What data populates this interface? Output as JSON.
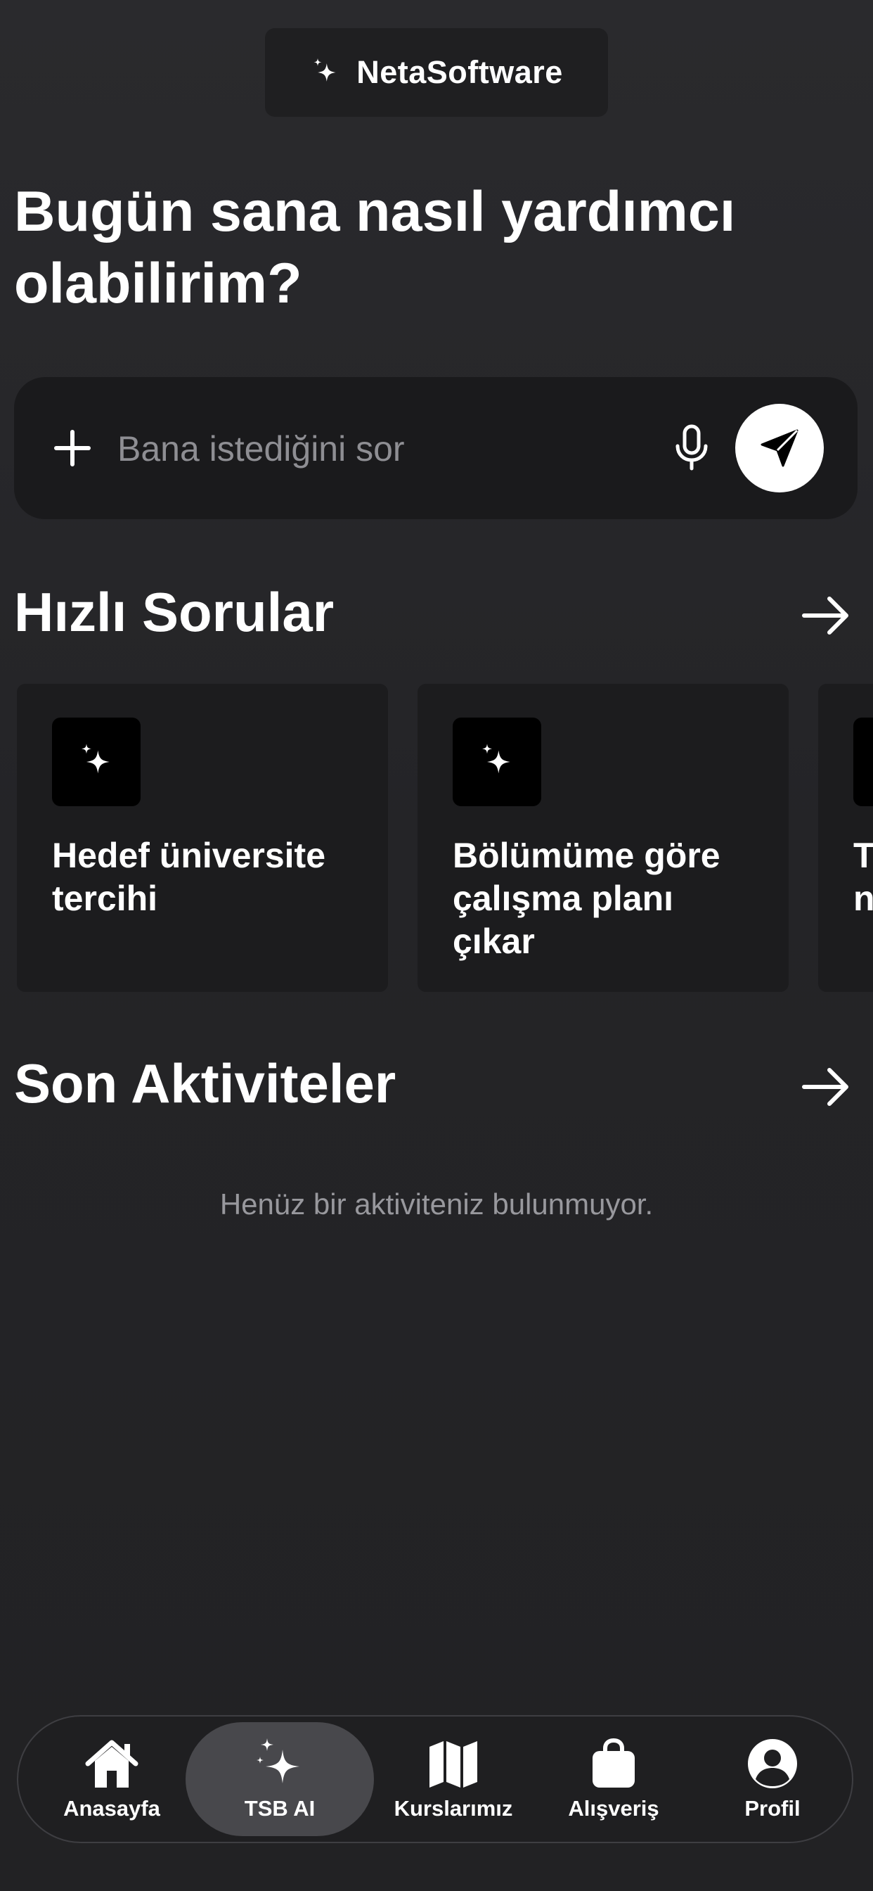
{
  "brand": {
    "name": "NetaSoftware",
    "icon": "sparkles-icon"
  },
  "hero": {
    "title": "Bugün sana nasıl yardımcı olabilirim?"
  },
  "search": {
    "placeholder": "Bana istediğini sor",
    "value": "",
    "icons": [
      "plus-icon",
      "microphone-icon",
      "send-icon"
    ]
  },
  "quick_questions": {
    "title": "Hızlı Sorular",
    "cards": [
      {
        "label": "Hedef üniversite tercihi",
        "icon": "sparkles-icon"
      },
      {
        "label": "Bölümüme göre çalışma planı çıkar",
        "icon": "sparkles-icon"
      },
      {
        "label": "T\nn",
        "icon": "sparkles-icon"
      }
    ]
  },
  "recent_activity": {
    "title": "Son Aktiviteler",
    "empty_message": "Henüz bir aktiviteniz bulunmuyor."
  },
  "tabbar": {
    "items": [
      {
        "label": "Anasayfa",
        "icon": "home-icon"
      },
      {
        "label": "TSB AI",
        "icon": "sparkles-icon",
        "active": true
      },
      {
        "label": "Kurslarımız",
        "icon": "map-icon"
      },
      {
        "label": "Alışveriş",
        "icon": "bag-icon"
      },
      {
        "label": "Profil",
        "icon": "profile-icon"
      }
    ]
  },
  "colors": {
    "background": "#252528",
    "surface": "#1c1c1e",
    "active_tab": "#48484c",
    "placeholder": "#8e8e93"
  }
}
